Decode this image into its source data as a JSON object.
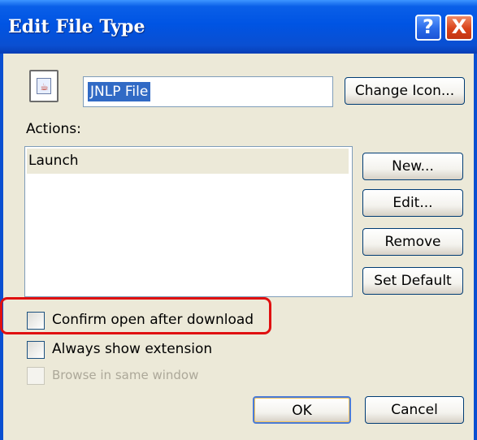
{
  "window": {
    "title": "Edit File Type",
    "help_glyph": "?",
    "close_glyph": "X"
  },
  "file": {
    "icon": "java-jnlp-file-icon",
    "name_value": "JNLP File",
    "change_icon_label": "Change Icon..."
  },
  "actions": {
    "label": "Actions:",
    "items": [
      "Launch"
    ],
    "selected_index": 0,
    "buttons": {
      "new": "New...",
      "edit": "Edit...",
      "remove": "Remove",
      "set_default": "Set Default"
    }
  },
  "options": {
    "confirm_open": {
      "label": "Confirm open after download",
      "checked": false,
      "enabled": true,
      "highlighted": true
    },
    "always_show_ext": {
      "label": "Always show extension",
      "checked": false,
      "enabled": true
    },
    "browse_same_window": {
      "label": "Browse in same window",
      "checked": false,
      "enabled": false
    }
  },
  "footer": {
    "ok_label": "OK",
    "cancel_label": "Cancel"
  },
  "colors": {
    "titlebar": "#0054e3",
    "dialog_bg": "#ece9d8",
    "selection": "#316ac5",
    "highlight_border": "#e01010"
  }
}
